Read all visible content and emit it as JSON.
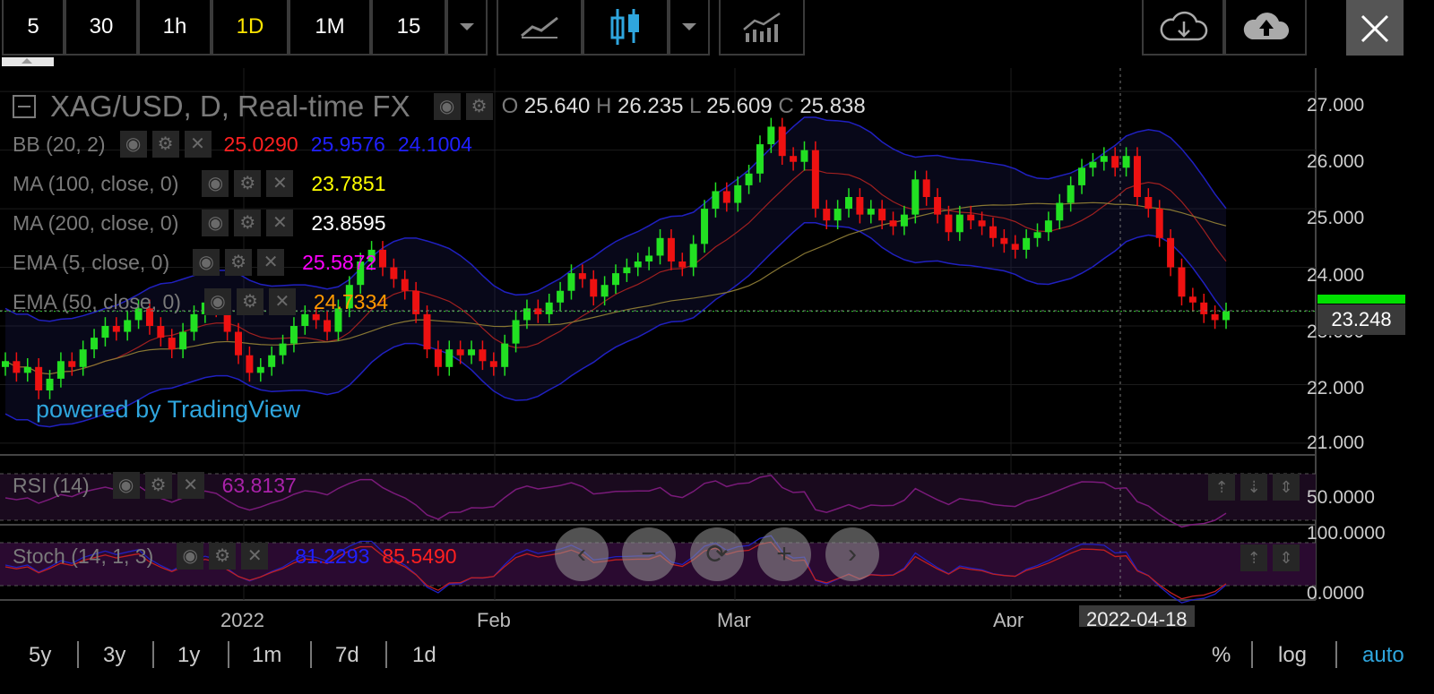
{
  "toolbar": {
    "intervals": [
      "5",
      "30",
      "1h",
      "1D",
      "1M",
      "15"
    ],
    "active_interval": "1D"
  },
  "chart": {
    "symbol_title": "XAG/USD, D, Real-time FX",
    "ohlc": {
      "o_label": "O",
      "o": "25.640",
      "h_label": "H",
      "h": "26.235",
      "l_label": "L",
      "l": "25.609",
      "c_label": "C",
      "c": "25.838"
    },
    "indicators": [
      {
        "name": "BB (20, 2)",
        "values": [
          "25.0290",
          "25.9576",
          "24.1004"
        ],
        "colors": [
          "#ff2020",
          "#2020ff",
          "#2020ff"
        ]
      },
      {
        "name": "MA (100, close, 0)",
        "values": [
          "23.7851"
        ],
        "colors": [
          "#ffff00"
        ]
      },
      {
        "name": "MA (200, close, 0)",
        "values": [
          "23.8595"
        ],
        "colors": [
          "#ffffff"
        ]
      },
      {
        "name": "EMA (5, close, 0)",
        "values": [
          "25.5872"
        ],
        "colors": [
          "#ff00ff"
        ]
      },
      {
        "name": "EMA (50, close, 0)",
        "values": [
          "24.7334"
        ],
        "colors": [
          "#ff9900"
        ]
      }
    ],
    "watermark": "powered by TradingView",
    "price_axis": [
      "27.000",
      "26.000",
      "25.000",
      "24.000",
      "23.000",
      "22.000",
      "21.000"
    ],
    "last_price": "23.248",
    "last_price_color": "#30d030",
    "rsi": {
      "name": "RSI (14)",
      "value": "63.8137",
      "value_color": "#aa22aa",
      "axis": [
        "50.0000"
      ]
    },
    "stoch": {
      "name": "Stoch (14, 1, 3)",
      "values": [
        "81.2293",
        "85.5490"
      ],
      "colors": [
        "#2020ff",
        "#ff2020"
      ],
      "axis": [
        "100.0000",
        "0.0000"
      ]
    },
    "time_axis": [
      "2022",
      "Feb",
      "Mar",
      "Apr"
    ],
    "crosshair_date": "2022-04-18",
    "nav_buttons": [
      "‹",
      "−",
      "⟳",
      "+",
      "›"
    ]
  },
  "bottombar": {
    "ranges": [
      "5y",
      "3y",
      "1y",
      "1m",
      "7d",
      "1d"
    ],
    "options": [
      "%",
      "log",
      "auto"
    ],
    "active_option": "auto",
    "accent": "#2fa6de"
  },
  "chart_data": {
    "type": "candlestick",
    "title": "XAG/USD, D, Real-time FX",
    "xlabel": "",
    "ylabel": "",
    "ylim": [
      20.8,
      27.4
    ],
    "x_ticks": [
      "2022",
      "Feb",
      "Mar",
      "Apr"
    ],
    "highlighted_date": "2022-04-18",
    "grid": true,
    "series": [
      {
        "name": "XAG/USD",
        "close": [
          22.4,
          22.2,
          22.3,
          21.9,
          22.1,
          22.4,
          22.3,
          22.6,
          22.8,
          23.0,
          22.9,
          23.1,
          23.3,
          23.0,
          22.8,
          22.6,
          22.9,
          23.2,
          23.4,
          23.3,
          22.9,
          22.5,
          22.2,
          22.3,
          22.5,
          22.7,
          23.0,
          23.2,
          23.1,
          22.9,
          23.3,
          23.7,
          24.1,
          24.3,
          24.0,
          23.8,
          23.6,
          23.2,
          22.6,
          22.3,
          22.6,
          22.5,
          22.6,
          22.4,
          22.3,
          22.7,
          23.1,
          23.3,
          23.2,
          23.4,
          23.6,
          23.9,
          23.8,
          23.5,
          23.7,
          23.9,
          24.0,
          24.1,
          24.2,
          24.5,
          24.1,
          24.0,
          24.4,
          25.0,
          25.3,
          25.1,
          25.4,
          25.6,
          26.1,
          26.4,
          25.9,
          25.8,
          26.0,
          25.0,
          24.8,
          25.0,
          25.2,
          24.9,
          25.0,
          24.8,
          24.7,
          24.9,
          25.5,
          25.2,
          24.9,
          24.6,
          24.9,
          24.8,
          24.7,
          24.5,
          24.4,
          24.3,
          24.5,
          24.6,
          24.8,
          25.1,
          25.4,
          25.7,
          25.8,
          25.9,
          25.7,
          25.9,
          25.2,
          25.0,
          24.5,
          24.0,
          23.5,
          23.4,
          23.2,
          23.1,
          23.248
        ]
      },
      {
        "name": "RSI (14)",
        "last": 63.8137
      },
      {
        "name": "Stoch (14, 1, 3)",
        "k": 81.2293,
        "d": 85.549
      }
    ]
  }
}
